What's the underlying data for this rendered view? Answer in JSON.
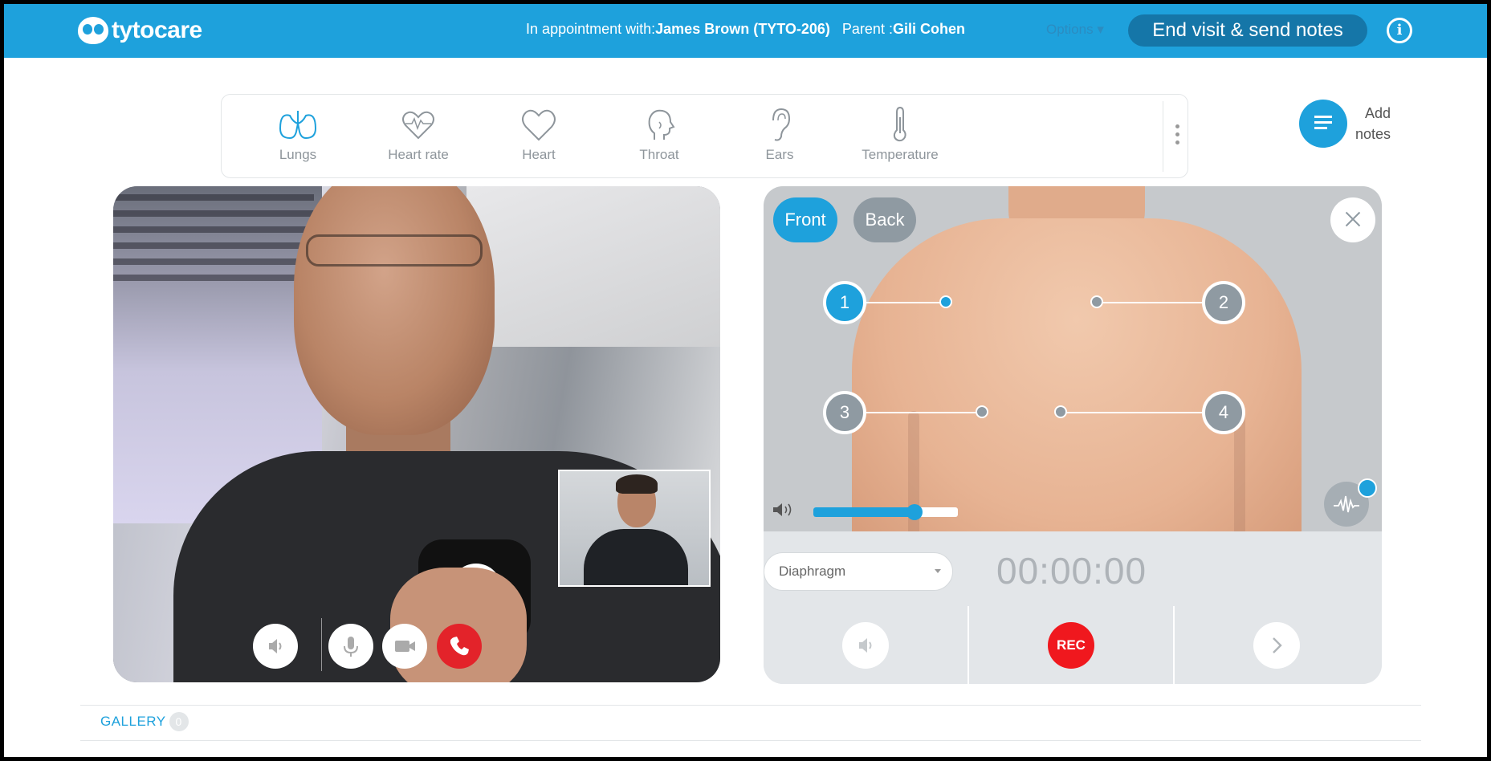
{
  "header": {
    "logo_text": "tytocare",
    "appointment_prefix": "In appointment with:",
    "patient": "James Brown (TYTO-206)",
    "parent_prefix": "Parent :",
    "parent": "Gili Cohen",
    "options_label": "Options",
    "end_visit_label": "End visit & send notes",
    "info_label": "i"
  },
  "exam_tools": [
    {
      "label": "Lungs",
      "icon": "lungs-icon"
    },
    {
      "label": "Heart rate",
      "icon": "heart-rate-icon"
    },
    {
      "label": "Heart",
      "icon": "heart-icon"
    },
    {
      "label": "Throat",
      "icon": "throat-icon"
    },
    {
      "label": "Ears",
      "icon": "ear-icon"
    },
    {
      "label": "Temperature",
      "icon": "thermometer-icon"
    }
  ],
  "notes": {
    "label_line1": "Add",
    "label_line2": "notes",
    "icon": "notes-icon"
  },
  "auscultation": {
    "front_label": "Front",
    "back_label": "Back",
    "points": [
      "1",
      "2",
      "3",
      "4"
    ],
    "active_point": "1",
    "volume": 0.7,
    "mode": "Diaphragm",
    "timer": "00:00:00",
    "rec_label": "REC"
  },
  "gallery": {
    "label": "GALLERY",
    "count": "0"
  },
  "colors": {
    "brand": "#1ea1dc",
    "dark_brand": "#1576a8",
    "record": "#f0181e",
    "hangup": "#e3232a",
    "inactive": "#8f9aa2"
  }
}
